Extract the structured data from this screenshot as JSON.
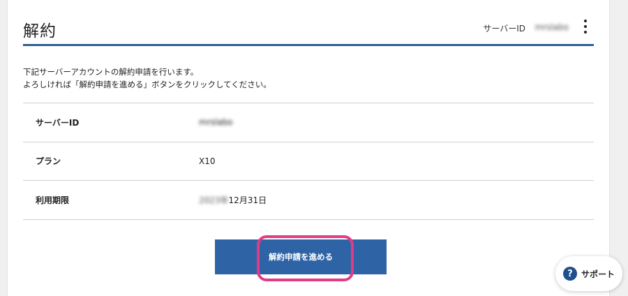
{
  "header": {
    "title": "解約",
    "server_id_label": "サーバーID",
    "server_id_value": "mrslabo"
  },
  "intro": {
    "line1": "下記サーバーアカウントの解約申請を行います。",
    "line2": "よろしければ「解約申請を進める」ボタンをクリックしてください。"
  },
  "details": [
    {
      "label": "サーバーID",
      "value": "mrslabo"
    },
    {
      "label": "プラン",
      "value": "X10"
    },
    {
      "label": "利用期限",
      "value_blurred": "2023年",
      "value": "12月31日"
    }
  ],
  "actions": {
    "proceed_label": "解約申請を進める"
  },
  "support": {
    "icon_glyph": "?",
    "label": "サポート"
  },
  "colors": {
    "accent": "#2e64a6",
    "header_rule": "#2e5f93",
    "highlight": "#e23b86",
    "help_icon": "#1f4f8c"
  }
}
